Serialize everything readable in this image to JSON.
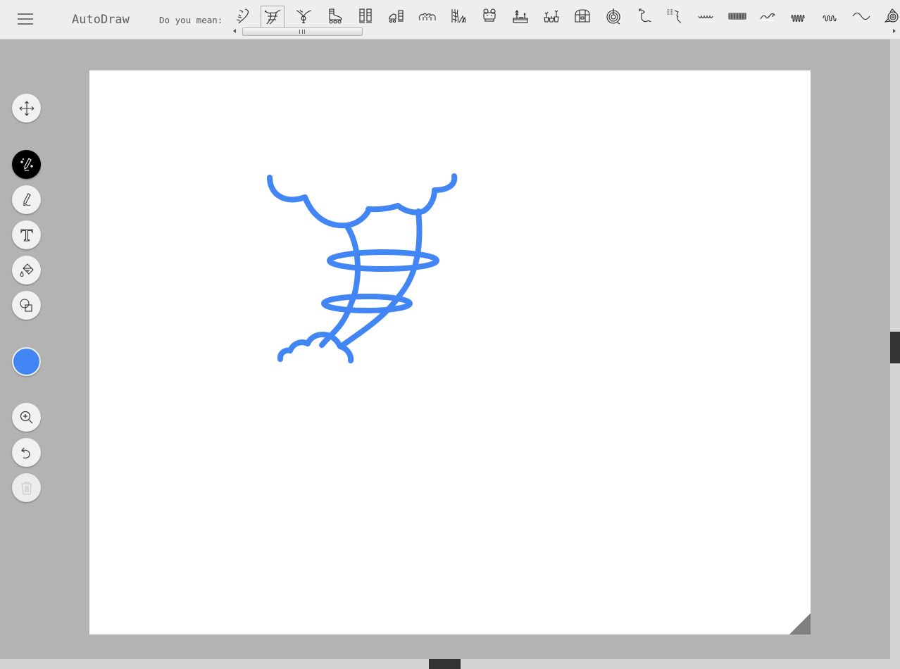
{
  "app": {
    "title": "AutoDraw",
    "menu_icon": "hamburger-menu-icon"
  },
  "suggestions": {
    "label": "Do you mean:",
    "selected_index": 1,
    "items": [
      {
        "name": "tornado-sketch-1"
      },
      {
        "name": "tornado-sketch-2"
      },
      {
        "name": "tornado-sketch-3"
      },
      {
        "name": "roller-skate"
      },
      {
        "name": "ski-boots"
      },
      {
        "name": "roller-skates-pair"
      },
      {
        "name": "animals-herd"
      },
      {
        "name": "vines-plants"
      },
      {
        "name": "frog-robot"
      },
      {
        "name": "garden-planter"
      },
      {
        "name": "potted-plants"
      },
      {
        "name": "treasure-chest"
      },
      {
        "name": "garden-hose-reel"
      },
      {
        "name": "hose-nozzle"
      },
      {
        "name": "sprayer-nozzle"
      },
      {
        "name": "small-waves"
      },
      {
        "name": "fence-pattern"
      },
      {
        "name": "ocean-wave"
      },
      {
        "name": "dense-squiggle"
      },
      {
        "name": "squiggle"
      },
      {
        "name": "sine-wave"
      },
      {
        "name": "rose"
      }
    ]
  },
  "toolbar": {
    "tools": [
      {
        "name": "move-tool",
        "icon": "move-arrows-icon",
        "state": "normal"
      },
      {
        "name": "autodraw-tool",
        "icon": "sparkle-pencil-icon",
        "state": "active"
      },
      {
        "name": "draw-tool",
        "icon": "pencil-icon",
        "state": "normal"
      },
      {
        "name": "type-tool",
        "icon": "text-t-icon",
        "state": "normal"
      },
      {
        "name": "fill-tool",
        "icon": "paint-bucket-icon",
        "state": "normal"
      },
      {
        "name": "shape-tool",
        "icon": "shapes-icon",
        "state": "normal"
      },
      {
        "name": "zoom-tool",
        "icon": "zoom-in-icon",
        "state": "normal"
      },
      {
        "name": "undo-button",
        "icon": "undo-icon",
        "state": "normal"
      },
      {
        "name": "delete-button",
        "icon": "trash-icon",
        "state": "disabled"
      }
    ],
    "current_color": "#4285f4"
  },
  "canvas": {
    "background": "#ffffff",
    "stroke_color": "#4285f4",
    "drawing_subject": "tornado"
  }
}
